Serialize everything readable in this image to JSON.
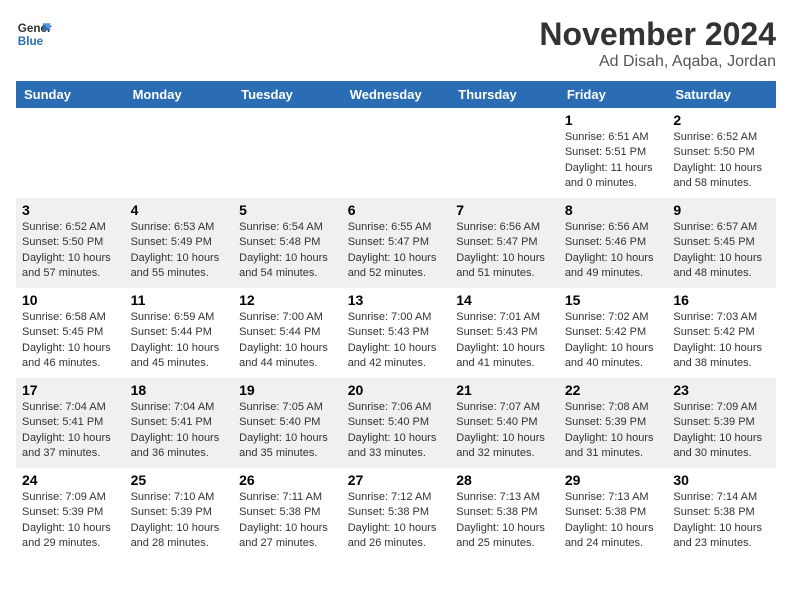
{
  "logo": {
    "line1": "General",
    "line2": "Blue"
  },
  "title": "November 2024",
  "subtitle": "Ad Disah, Aqaba, Jordan",
  "weekdays": [
    "Sunday",
    "Monday",
    "Tuesday",
    "Wednesday",
    "Thursday",
    "Friday",
    "Saturday"
  ],
  "weeks": [
    [
      {
        "day": "",
        "info": ""
      },
      {
        "day": "",
        "info": ""
      },
      {
        "day": "",
        "info": ""
      },
      {
        "day": "",
        "info": ""
      },
      {
        "day": "",
        "info": ""
      },
      {
        "day": "1",
        "info": "Sunrise: 6:51 AM\nSunset: 5:51 PM\nDaylight: 11 hours and 0 minutes."
      },
      {
        "day": "2",
        "info": "Sunrise: 6:52 AM\nSunset: 5:50 PM\nDaylight: 10 hours and 58 minutes."
      }
    ],
    [
      {
        "day": "3",
        "info": "Sunrise: 6:52 AM\nSunset: 5:50 PM\nDaylight: 10 hours and 57 minutes."
      },
      {
        "day": "4",
        "info": "Sunrise: 6:53 AM\nSunset: 5:49 PM\nDaylight: 10 hours and 55 minutes."
      },
      {
        "day": "5",
        "info": "Sunrise: 6:54 AM\nSunset: 5:48 PM\nDaylight: 10 hours and 54 minutes."
      },
      {
        "day": "6",
        "info": "Sunrise: 6:55 AM\nSunset: 5:47 PM\nDaylight: 10 hours and 52 minutes."
      },
      {
        "day": "7",
        "info": "Sunrise: 6:56 AM\nSunset: 5:47 PM\nDaylight: 10 hours and 51 minutes."
      },
      {
        "day": "8",
        "info": "Sunrise: 6:56 AM\nSunset: 5:46 PM\nDaylight: 10 hours and 49 minutes."
      },
      {
        "day": "9",
        "info": "Sunrise: 6:57 AM\nSunset: 5:45 PM\nDaylight: 10 hours and 48 minutes."
      }
    ],
    [
      {
        "day": "10",
        "info": "Sunrise: 6:58 AM\nSunset: 5:45 PM\nDaylight: 10 hours and 46 minutes."
      },
      {
        "day": "11",
        "info": "Sunrise: 6:59 AM\nSunset: 5:44 PM\nDaylight: 10 hours and 45 minutes."
      },
      {
        "day": "12",
        "info": "Sunrise: 7:00 AM\nSunset: 5:44 PM\nDaylight: 10 hours and 44 minutes."
      },
      {
        "day": "13",
        "info": "Sunrise: 7:00 AM\nSunset: 5:43 PM\nDaylight: 10 hours and 42 minutes."
      },
      {
        "day": "14",
        "info": "Sunrise: 7:01 AM\nSunset: 5:43 PM\nDaylight: 10 hours and 41 minutes."
      },
      {
        "day": "15",
        "info": "Sunrise: 7:02 AM\nSunset: 5:42 PM\nDaylight: 10 hours and 40 minutes."
      },
      {
        "day": "16",
        "info": "Sunrise: 7:03 AM\nSunset: 5:42 PM\nDaylight: 10 hours and 38 minutes."
      }
    ],
    [
      {
        "day": "17",
        "info": "Sunrise: 7:04 AM\nSunset: 5:41 PM\nDaylight: 10 hours and 37 minutes."
      },
      {
        "day": "18",
        "info": "Sunrise: 7:04 AM\nSunset: 5:41 PM\nDaylight: 10 hours and 36 minutes."
      },
      {
        "day": "19",
        "info": "Sunrise: 7:05 AM\nSunset: 5:40 PM\nDaylight: 10 hours and 35 minutes."
      },
      {
        "day": "20",
        "info": "Sunrise: 7:06 AM\nSunset: 5:40 PM\nDaylight: 10 hours and 33 minutes."
      },
      {
        "day": "21",
        "info": "Sunrise: 7:07 AM\nSunset: 5:40 PM\nDaylight: 10 hours and 32 minutes."
      },
      {
        "day": "22",
        "info": "Sunrise: 7:08 AM\nSunset: 5:39 PM\nDaylight: 10 hours and 31 minutes."
      },
      {
        "day": "23",
        "info": "Sunrise: 7:09 AM\nSunset: 5:39 PM\nDaylight: 10 hours and 30 minutes."
      }
    ],
    [
      {
        "day": "24",
        "info": "Sunrise: 7:09 AM\nSunset: 5:39 PM\nDaylight: 10 hours and 29 minutes."
      },
      {
        "day": "25",
        "info": "Sunrise: 7:10 AM\nSunset: 5:39 PM\nDaylight: 10 hours and 28 minutes."
      },
      {
        "day": "26",
        "info": "Sunrise: 7:11 AM\nSunset: 5:38 PM\nDaylight: 10 hours and 27 minutes."
      },
      {
        "day": "27",
        "info": "Sunrise: 7:12 AM\nSunset: 5:38 PM\nDaylight: 10 hours and 26 minutes."
      },
      {
        "day": "28",
        "info": "Sunrise: 7:13 AM\nSunset: 5:38 PM\nDaylight: 10 hours and 25 minutes."
      },
      {
        "day": "29",
        "info": "Sunrise: 7:13 AM\nSunset: 5:38 PM\nDaylight: 10 hours and 24 minutes."
      },
      {
        "day": "30",
        "info": "Sunrise: 7:14 AM\nSunset: 5:38 PM\nDaylight: 10 hours and 23 minutes."
      }
    ]
  ]
}
